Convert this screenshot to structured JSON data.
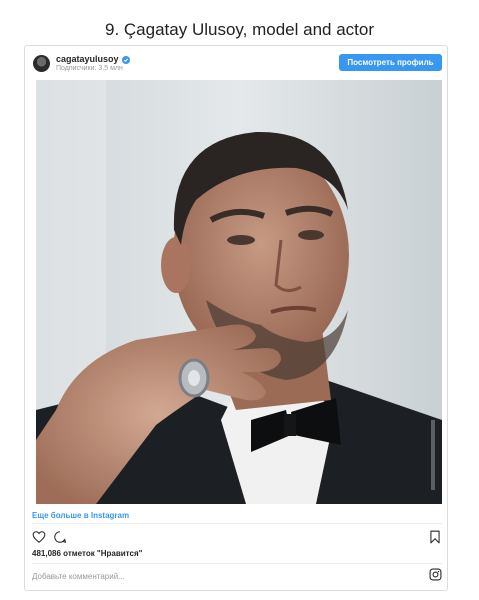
{
  "heading": "9. Çagatay Ulusoy, model and actor",
  "post": {
    "username": "cagatayulusoy",
    "followers": "Подписчики: 3.5 млн",
    "view_profile_label": "Посмотреть профиль",
    "more_link": "Еще больше в Instagram",
    "likes": "481,086 отметок \"Нравится\"",
    "comment_placeholder": "Добавьте комментарий..."
  },
  "colors": {
    "accent": "#3897f0",
    "border": "#dbdbdb",
    "text": "#262626",
    "muted": "#999999"
  },
  "icons": {
    "verified": "verified-badge-icon",
    "like": "heart-icon",
    "comment": "comment-bubble-icon",
    "save": "bookmark-icon",
    "instagram": "instagram-logo-icon"
  }
}
